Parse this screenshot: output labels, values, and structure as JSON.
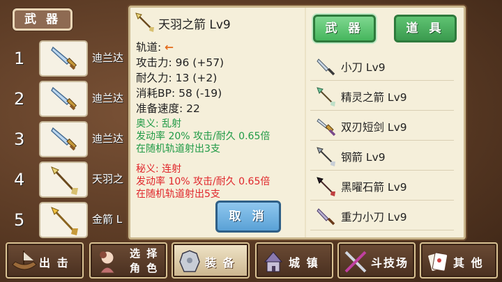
{
  "header": {
    "tab_label": "武 器"
  },
  "equipped": [
    {
      "num": "1",
      "name": "迪兰达"
    },
    {
      "num": "2",
      "name": "迪兰达"
    },
    {
      "num": "3",
      "name": "迪兰达"
    },
    {
      "num": "4",
      "name": "天羽之"
    },
    {
      "num": "5",
      "name": "金箭 L"
    }
  ],
  "detail": {
    "title": "天羽之箭 Lv9",
    "track_label": "轨道:",
    "track_arrow": "←",
    "attack": "攻击力: 96 (+57)",
    "durability": "耐久力: 13 (+2)",
    "bp_cost": "消耗BP: 58 (-19)",
    "prep_speed": "准备速度: 22",
    "skill1": {
      "line1": "奥义: 乱射",
      "line2": "发动率 20%  攻击/耐久 0.65倍",
      "line3": "在随机轨道射出3支"
    },
    "skill2": {
      "line1": "秘义: 连射",
      "line2": "发动率 10%   攻击/耐久 0.65倍",
      "line3": "在随机轨道射出5支"
    },
    "cancel_label": "取 消"
  },
  "tabs": {
    "weapons": "武 器",
    "items": "道 具"
  },
  "inventory": [
    {
      "name": "小刀 Lv9",
      "icon": "knife-icon"
    },
    {
      "name": "精灵之箭 Lv9",
      "icon": "arrow-icon"
    },
    {
      "name": "双刃短剑 Lv9",
      "icon": "dagger-icon"
    },
    {
      "name": "钢箭 Lv9",
      "icon": "arrow-icon"
    },
    {
      "name": "黑曜石箭 Lv9",
      "icon": "arrow-icon"
    },
    {
      "name": "重力小刀 Lv9",
      "icon": "knife-icon"
    }
  ],
  "nav": {
    "sortie": "出 击",
    "select_line1": "选 择",
    "select_line2": "角 色",
    "equip": "装 备",
    "town": "城 镇",
    "arena": "斗技场",
    "other": "其 他"
  },
  "colors": {
    "green_skill": "#1f9a45",
    "red_skill": "#e0262b",
    "track_arrow": "#e46b1a"
  }
}
